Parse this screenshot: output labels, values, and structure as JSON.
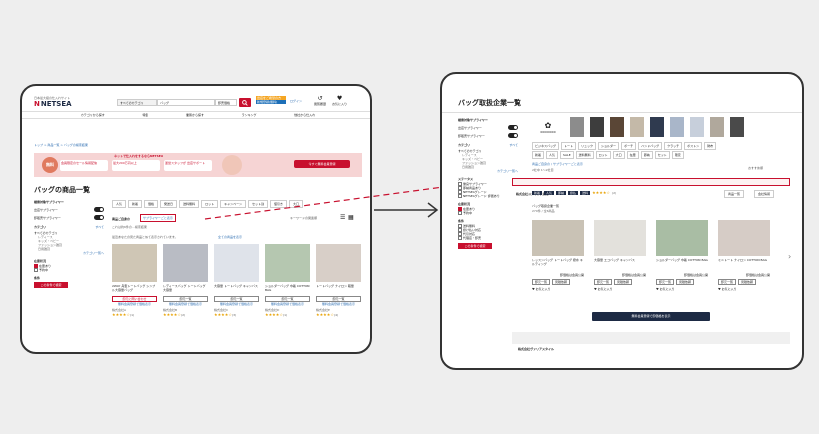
{
  "left": {
    "header": {
      "logo_tagline": "日本最大級の仕入れサイト",
      "logo": "NETSEA",
      "category_select": "すべてのカテゴリ",
      "search_value": "バッグ",
      "search_mode": "卸売価格",
      "banner_btn_top": "出店をご希望の方",
      "banner_btn_bottom": "新規登録(無料)",
      "login_link": "ログイン",
      "history_label": "閲覧履歴",
      "wishlist_label": "お気に入り"
    },
    "nav": [
      "カテゴリから探す",
      "特集",
      "業態から探す",
      "ランキング",
      "他社から仕入れ"
    ],
    "breadcrumb": "トップ > 商品一覧 > バッグの検索結果",
    "promo": {
      "left_badge": "無料",
      "left_text": "会員限定のセール情報配信",
      "middle_text": "最大200万円以上",
      "right_text": "運営スタッフが 出店サポート",
      "title": "ネットで仕入れをするならNETSEA",
      "cta": "今すぐ無料会員登録"
    },
    "page_title": "バッグの商品一覧",
    "sidebar": {
      "search_filter": "検索対象サプライヤー",
      "toggle1": "出店サプライヤー",
      "toggle2": "卸販売サプライヤー",
      "category_title": "カテゴリ",
      "category_clear": "すべて",
      "categories": [
        "すべてのカテゴリ",
        "レディース",
        "キッズ・ベビー",
        "ファッション雑貨",
        "日用雑貨"
      ],
      "more_link": "カテゴリ一覧へ",
      "stock_title": "在庫状況",
      "stock_opt1": "在庫あり",
      "stock_opt2": "予約中",
      "condition_title": "条件",
      "search_btn": "この条件で検索"
    },
    "filter_chips": [
      "人気",
      "新着",
      "価格",
      "発送日",
      "送料無料",
      "ロット",
      "キャンペーン",
      "セット割",
      "値引き",
      "大口"
    ],
    "supplier_label": "商品ご自身の",
    "supplier_filter": "サプライヤーごと表示",
    "result_count": "これは約6件の…検索結果",
    "sort": "キーワードの関連順",
    "notice": "最近あなたの見た商品と似て表示されています。",
    "notice_link": "全ての商品を表示",
    "products": [
      {
        "title": "2WAY 舟型トートバッグ シンプル大容量バッグ",
        "btn": "卸元に問い合わせ",
        "link": "無料会員登録で価格表示",
        "store": "株式会社A",
        "rating": "★★★★☆",
        "count": "(1)"
      },
      {
        "title": "レディースバッグ トートバッグ大容量",
        "btn": "卸元一覧",
        "link": "無料会員登録で価格表示",
        "store": "株式会社B",
        "rating": "★★★★☆",
        "count": "(2)"
      },
      {
        "title": "大容量 トートバッグ キャンバス",
        "btn": "卸元一覧",
        "link": "無料会員登録で価格表示",
        "store": "株式会社C",
        "rating": "★★★★☆",
        "count": "(3)"
      },
      {
        "title": "ショルダーバッグ 巾着 COTTON BAG",
        "btn": "卸元一覧",
        "link": "無料会員登録で価格表示",
        "store": "株式会社D",
        "rating": "★★★★☆",
        "count": "(1)"
      },
      {
        "title": "トートバッグ ナイロン 軽量",
        "btn": "卸元一覧",
        "link": "無料会員登録で価格表示",
        "store": "株式会社E",
        "rating": "★★★★☆",
        "count": "(4)"
      }
    ]
  },
  "right": {
    "page_title": "バッグ取扱企業一覧",
    "sidebar": {
      "search_filter": "検索対象サプライヤー",
      "toggle1": "出店サプライヤー",
      "toggle2": "卸販売サプライヤー",
      "category_title": "カテゴリ",
      "category_clear": "すべて",
      "categories": [
        "すべてのカテゴリ",
        "レディース",
        "キッズ・ベビー",
        "ファッション雑貨",
        "日用雑貨"
      ],
      "more_link": "カテゴリ一覧へ",
      "status_title": "ステータス",
      "statuses": [
        "優良サプライヤー",
        "即納商品あり",
        "NETSEAグレード",
        "NETSEAグレード 評価あり"
      ],
      "stock_title": "在庫状況",
      "stock_opt1": "在庫あり",
      "stock_opt2": "予約中",
      "condition_title": "条件",
      "conditions": [
        "送料無料",
        "掛け払い対応",
        "代引対応",
        "代理店・卸売"
      ],
      "search_btn": "この条件で検索"
    },
    "brand_logo": "00000000",
    "chips_row1": [
      "ビジネスバッグ",
      "トート",
      "リュック",
      "ショルダー",
      "ポーチ",
      "ハンドバッグ",
      "クラッチ",
      "ボストン",
      "財布"
    ],
    "chips_row2": [
      "新着",
      "人気",
      "SALE",
      "送料無料",
      "ロット",
      "大口",
      "在庫",
      "即納",
      "セット",
      "限定"
    ],
    "result_label": "商品ご自身の",
    "supplier_filter": "サプライヤーごと表示",
    "result_sub": "2社中 1〜2社目",
    "sort": "おすすめ順",
    "company_name": "株式会社ユメックス商事",
    "company_tags": [
      "新着",
      "人気",
      "即納",
      "掛払",
      "送料"
    ],
    "company_rating": "★★★★☆",
    "company_count": "(2)",
    "company_btn1": "商品一覧",
    "company_btn2": "会社情報",
    "company_note": "バッグ取扱企業一覧",
    "company_sub": "270件 / 全6商品",
    "products": [
      {
        "title": "レッスンバッグ トートバッグ 撥水 キルティング",
        "price": "卸価格は会員公開",
        "btn1": "卸元一覧",
        "btn2": "見積依頼",
        "fav": "お気に入り"
      },
      {
        "title": "大容量 エコバッグ キャンバス",
        "price": "卸価格は会員公開",
        "btn1": "卸元一覧",
        "btn2": "見積依頼",
        "fav": "お気に入り"
      },
      {
        "title": "ショルダーバッグ 巾着 COTTON BAG",
        "price": "卸価格は会員公開",
        "btn1": "卸元一覧",
        "btn2": "見積依頼",
        "fav": "お気に入り"
      },
      {
        "title": "ミニトート ナイロン COTTON BAG",
        "price": "卸価格は会員公開",
        "btn1": "卸元一覧",
        "btn2": "見積依頼",
        "fav": "お気に入り"
      }
    ],
    "cta": "無料会員登録で卸価格を表示",
    "company2_name": "株式会社ヴァリアスタイル"
  },
  "colors": {
    "accent": "#c8102e",
    "promo_bg": "#f6d4d4",
    "navy": "#1d2a44",
    "link": "#2b6cb0"
  }
}
